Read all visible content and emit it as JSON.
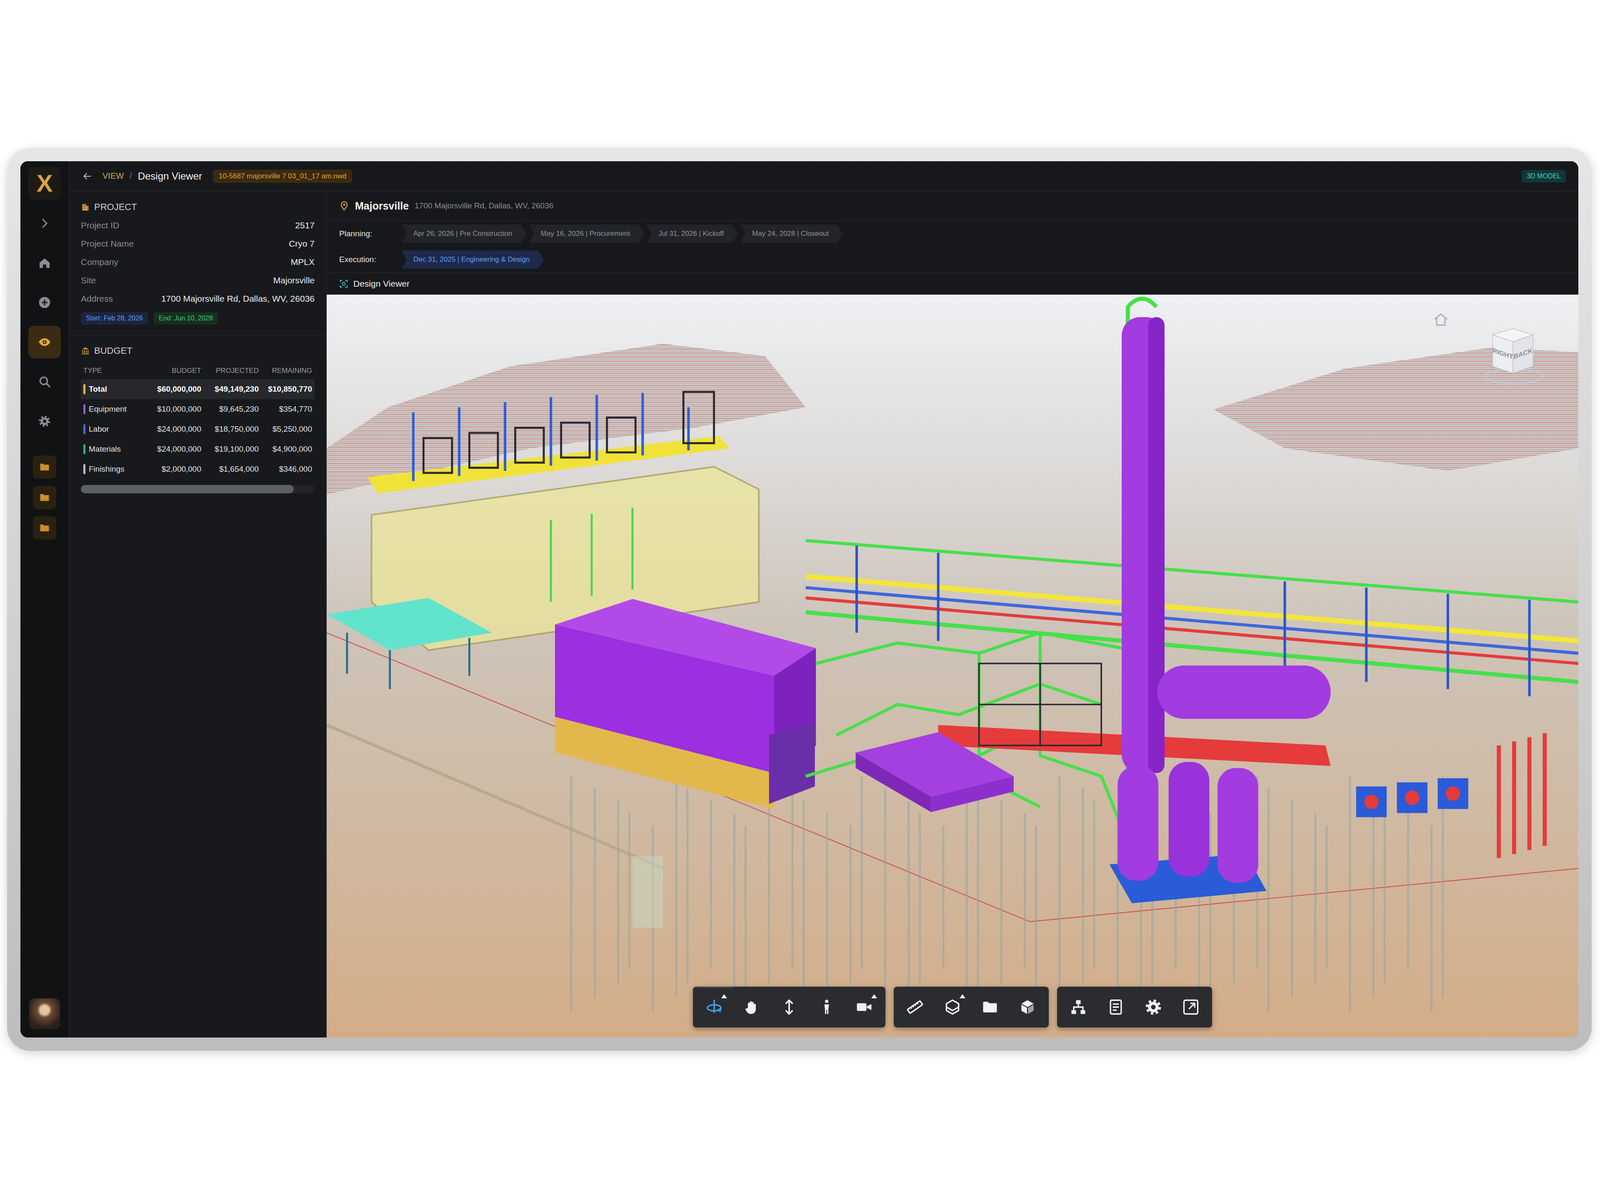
{
  "rail": {
    "logo": "X",
    "items": [
      {
        "kind": "expand",
        "selected": false
      },
      {
        "kind": "home",
        "selected": false
      },
      {
        "kind": "add",
        "selected": false
      },
      {
        "kind": "view",
        "selected": true
      },
      {
        "kind": "search",
        "selected": false
      },
      {
        "kind": "settings",
        "selected": false
      },
      {
        "kind": "folder",
        "selected": false
      },
      {
        "kind": "folder",
        "selected": false
      },
      {
        "kind": "folder",
        "selected": false
      }
    ]
  },
  "header": {
    "breadcrumb": "VIEW",
    "separator": "/",
    "title": "Design Viewer",
    "file": "10-5687 majorsville 7 03_01_17 am.nwd",
    "mode": "3D MODEL"
  },
  "project": {
    "title": "PROJECT",
    "fields": [
      {
        "label": "Project ID",
        "value": "2517"
      },
      {
        "label": "Project Name",
        "value": "Cryo 7"
      },
      {
        "label": "Company",
        "value": "MPLX"
      },
      {
        "label": "Site",
        "value": "Majorsville"
      },
      {
        "label": "Address",
        "value": "1700 Majorsville Rd, Dallas, WV, 26036"
      }
    ],
    "start": "Start: Feb 28, 2026",
    "end": "End: Jun 10, 2028"
  },
  "budget": {
    "title": "BUDGET",
    "columns": [
      "TYPE",
      "BUDGET",
      "PROJECTED",
      "REMAINING"
    ],
    "rows": [
      {
        "type": "Total",
        "budget": "$60,000,000",
        "projected": "$49,149,230",
        "remaining": "$10,850,770",
        "color": "#e8b931",
        "selected": true
      },
      {
        "type": "Equipment",
        "budget": "$10,000,000",
        "projected": "$9,645,230",
        "remaining": "$354,770",
        "color": "#8e5cd9",
        "selected": false
      },
      {
        "type": "Labor",
        "budget": "$24,000,000",
        "projected": "$18,750,000",
        "remaining": "$5,250,000",
        "color": "#3f6fe0",
        "selected": false
      },
      {
        "type": "Materials",
        "budget": "$24,000,000",
        "projected": "$19,100,000",
        "remaining": "$4,900,000",
        "color": "#2fb36b",
        "selected": false
      },
      {
        "type": "Finishings",
        "budget": "$2,000,000",
        "projected": "$1,654,000",
        "remaining": "$346,000",
        "color": "#b8bcc4",
        "selected": false
      }
    ],
    "scrollbar": {
      "level": 0.91
    }
  },
  "location": {
    "name": "Majorsville",
    "address": "1700 Majorsville Rd, Dallas, WV, 26036"
  },
  "timeline": {
    "planning_label": "Planning:",
    "planning": [
      {
        "label": "Apr 26, 2026 | Pre Construction",
        "selected": false
      },
      {
        "label": "May 16, 2026 | Procurement",
        "selected": false
      },
      {
        "label": "Jul 31, 2026 | Kickoff",
        "selected": false
      },
      {
        "label": "May 24, 2028 | Closeout",
        "selected": false
      }
    ],
    "execution_label": "Execution:",
    "execution": [
      {
        "label": "Dec 31, 2025 | Engineering & Design",
        "selected": true
      }
    ]
  },
  "viewer": {
    "title": "Design Viewer",
    "cube": {
      "faces": [
        "RIGHT",
        "BACK"
      ]
    },
    "toolbar": [
      [
        {
          "kind": "orbit",
          "selected": true,
          "menu": true
        },
        {
          "kind": "pan",
          "selected": false,
          "menu": false
        },
        {
          "kind": "zoom",
          "selected": false,
          "menu": false
        },
        {
          "kind": "walk",
          "selected": false,
          "menu": false
        },
        {
          "kind": "camera",
          "selected": false,
          "menu": true
        }
      ],
      [
        {
          "kind": "measure",
          "selected": false,
          "menu": false
        },
        {
          "kind": "section",
          "selected": false,
          "menu": true
        },
        {
          "kind": "folder",
          "selected": false,
          "menu": false
        },
        {
          "kind": "cube",
          "selected": false,
          "menu": false
        }
      ],
      [
        {
          "kind": "tree",
          "selected": false,
          "menu": false
        },
        {
          "kind": "properties",
          "selected": false,
          "menu": false
        },
        {
          "kind": "settings",
          "selected": false,
          "menu": false
        },
        {
          "kind": "fullscreen",
          "selected": false,
          "menu": false
        }
      ]
    ]
  }
}
